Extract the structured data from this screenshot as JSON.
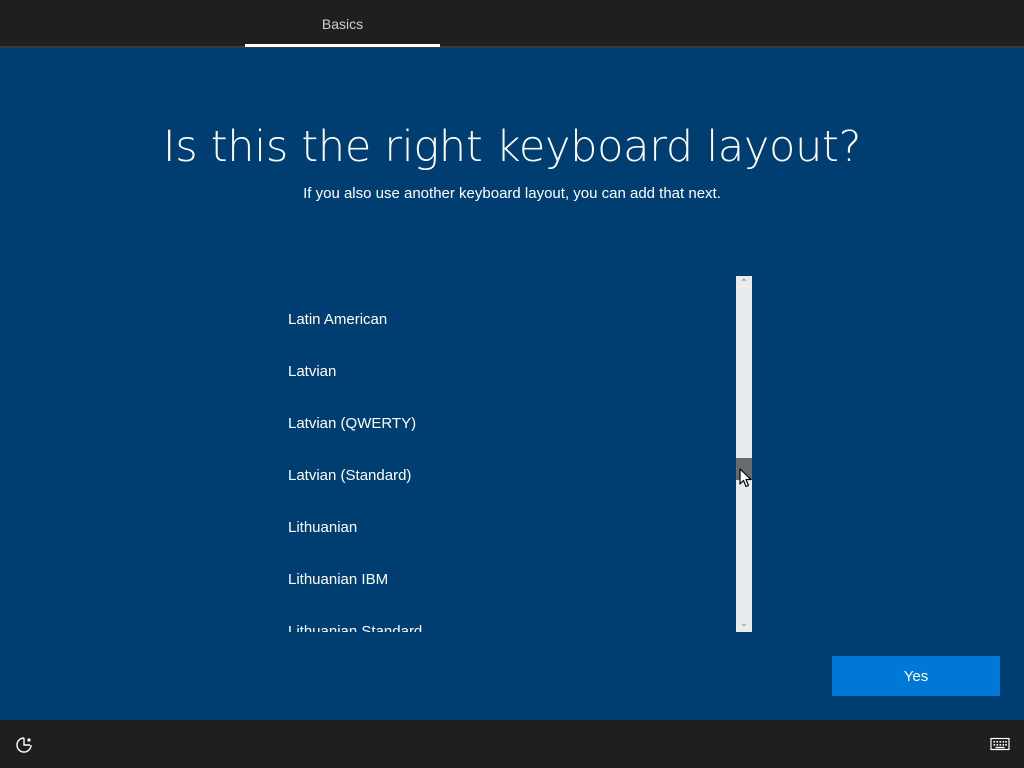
{
  "header": {
    "tabs": [
      {
        "label": "Basics",
        "active": true
      }
    ]
  },
  "main": {
    "title": "Is this the right keyboard layout?",
    "subtitle": "If you also use another keyboard layout, you can add that next."
  },
  "layout_list": {
    "items": [
      "Latin American",
      "Latvian",
      "Latvian (QWERTY)",
      "Latvian (Standard)",
      "Lithuanian",
      "Lithuanian IBM",
      "Lithuanian Standard"
    ],
    "scroll_up_glyph": "⌃",
    "scroll_down_glyph": "⌄"
  },
  "actions": {
    "yes_label": "Yes"
  },
  "footer": {
    "left_icon": "ease-of-access-icon",
    "right_icon": "keyboard-icon"
  },
  "colors": {
    "background": "#003e72",
    "accent": "#0078d7",
    "bar": "#1f1f1f"
  }
}
